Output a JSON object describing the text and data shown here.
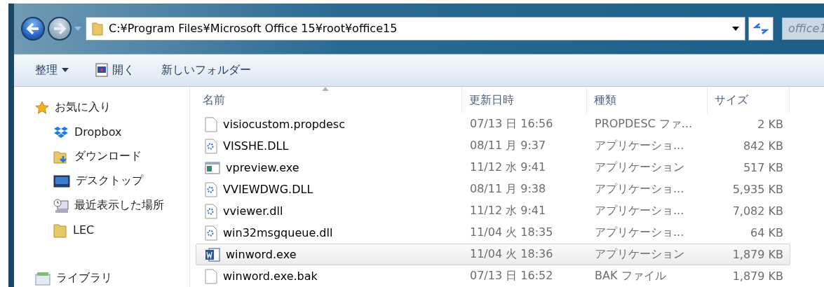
{
  "address_bar": {
    "path": "C:¥Program Files¥Microsoft Office 15¥root¥office15"
  },
  "search": {
    "placeholder": "office1"
  },
  "toolbar": {
    "items": [
      {
        "kind": "menu",
        "label": "整理"
      },
      {
        "kind": "open",
        "label": "開く"
      },
      {
        "kind": "plain",
        "label": "新しいフォルダー"
      }
    ]
  },
  "sidebar": {
    "items": [
      {
        "kind": "favorites",
        "label": "お気に入り",
        "children": [
          {
            "kind": "dropbox",
            "label": "Dropbox"
          },
          {
            "kind": "download",
            "label": "ダウンロード"
          },
          {
            "kind": "desktop",
            "label": "デスクトップ"
          },
          {
            "kind": "recent",
            "label": "最近表示した場所"
          },
          {
            "kind": "folder",
            "label": "LEC"
          }
        ]
      },
      {
        "kind": "library",
        "label": "ライブラリ"
      }
    ]
  },
  "table": {
    "columns": [
      {
        "label": "名前",
        "sorted": true
      },
      {
        "label": "更新日時",
        "sorted": false
      },
      {
        "label": "種類",
        "sorted": false
      },
      {
        "label": "サイズ",
        "sorted": false
      }
    ],
    "rows": [
      {
        "kind": "blank",
        "name": "visiocustom.propdesc",
        "date": "07/13 日 16:56",
        "type": "PROPDESC ファ...",
        "size": "2 KB",
        "selected": false
      },
      {
        "kind": "dll",
        "name": "VISSHE.DLL",
        "date": "08/11 月 9:37",
        "type": "アプリケーショ...",
        "size": "842 KB",
        "selected": false
      },
      {
        "kind": "exe",
        "name": "vpreview.exe",
        "date": "11/12 水 9:41",
        "type": "アプリケーション",
        "size": "517 KB",
        "selected": false
      },
      {
        "kind": "dll",
        "name": "VVIEWDWG.DLL",
        "date": "08/11 月 9:38",
        "type": "アプリケーショ...",
        "size": "5,935 KB",
        "selected": false
      },
      {
        "kind": "dll",
        "name": "vviewer.dll",
        "date": "11/12 水 9:41",
        "type": "アプリケーショ...",
        "size": "7,082 KB",
        "selected": false
      },
      {
        "kind": "dll",
        "name": "win32msgqueue.dll",
        "date": "11/04 火 18:35",
        "type": "アプリケーショ...",
        "size": "64 KB",
        "selected": false
      },
      {
        "kind": "word",
        "name": "winword.exe",
        "date": "11/04 火 18:36",
        "type": "アプリケーション",
        "size": "1,879 KB",
        "selected": true
      },
      {
        "kind": "blank",
        "name": "winword.exe.bak",
        "date": "07/13 日 16:52",
        "type": "BAK ファイル",
        "size": "1,879 KB",
        "selected": false
      }
    ]
  }
}
